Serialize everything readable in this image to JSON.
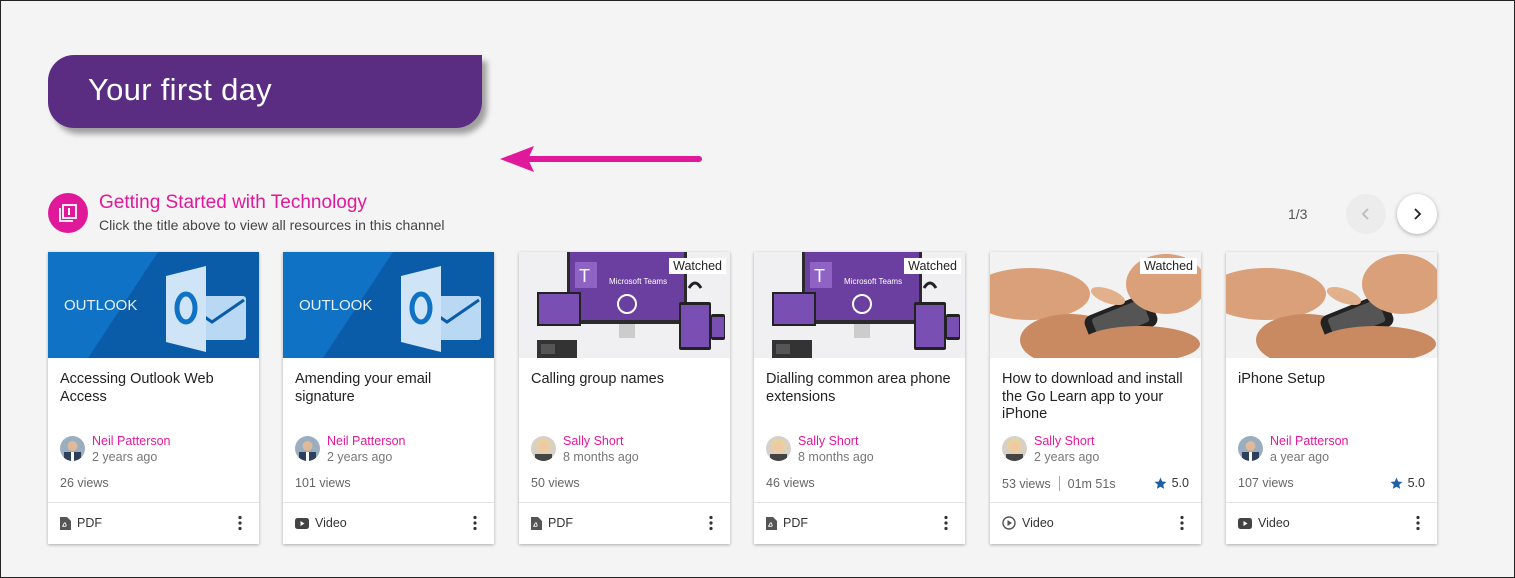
{
  "banner": {
    "title": "Your first day"
  },
  "channel": {
    "title": "Getting Started with Technology",
    "subtitle": "Click the title above to view all resources in this channel",
    "pager": "1/3"
  },
  "colors": {
    "accent": "#e0199b",
    "banner": "#5a2d82",
    "outlook_blue": "#0f72c4",
    "teams_purple": "#6b3fa0"
  },
  "cards": [
    {
      "thumb": "outlook",
      "thumb_text": "OUTLOOK",
      "watched": "",
      "title": "Accessing Outlook Web Access",
      "author": "Neil Patterson",
      "ago": "2 years ago",
      "views": "26 views",
      "duration": "",
      "rating": "",
      "type": "PDF",
      "type_icon": "pdf-icon"
    },
    {
      "thumb": "outlook",
      "thumb_text": "OUTLOOK",
      "watched": "",
      "title": "Amending your email signature",
      "author": "Neil Patterson",
      "ago": "2 years ago",
      "views": "101 views",
      "duration": "",
      "rating": "",
      "type": "Video",
      "type_icon": "video-icon"
    },
    {
      "thumb": "teams",
      "thumb_text": "Microsoft Teams",
      "watched": "Watched",
      "title": "Calling group names",
      "author": "Sally Short",
      "ago": "8 months ago",
      "views": "50 views",
      "duration": "",
      "rating": "",
      "type": "PDF",
      "type_icon": "pdf-icon"
    },
    {
      "thumb": "teams",
      "thumb_text": "Microsoft Teams",
      "watched": "Watched",
      "title": "Dialling common area phone extensions",
      "author": "Sally Short",
      "ago": "8 months ago",
      "views": "46 views",
      "duration": "",
      "rating": "",
      "type": "PDF",
      "type_icon": "pdf-icon"
    },
    {
      "thumb": "phone",
      "thumb_text": "",
      "watched": "Watched",
      "title": "How to download and install the Go Learn app to your iPhone",
      "author": "Sally Short",
      "ago": "2 years ago",
      "views": "53 views",
      "duration": "01m 51s",
      "rating": "5.0",
      "type": "Video",
      "type_icon": "play-circle-icon"
    },
    {
      "thumb": "phone",
      "thumb_text": "",
      "watched": "",
      "title": "iPhone Setup",
      "author": "Neil Patterson",
      "ago": "a year ago",
      "views": "107 views",
      "duration": "",
      "rating": "5.0",
      "type": "Video",
      "type_icon": "video-icon"
    }
  ]
}
